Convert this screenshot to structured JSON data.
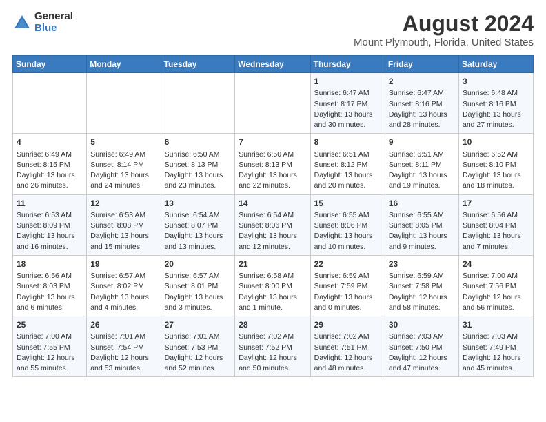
{
  "logo": {
    "line1": "General",
    "line2": "Blue"
  },
  "title": "August 2024",
  "subtitle": "Mount Plymouth, Florida, United States",
  "weekdays": [
    "Sunday",
    "Monday",
    "Tuesday",
    "Wednesday",
    "Thursday",
    "Friday",
    "Saturday"
  ],
  "weeks": [
    [
      {
        "day": "",
        "content": ""
      },
      {
        "day": "",
        "content": ""
      },
      {
        "day": "",
        "content": ""
      },
      {
        "day": "",
        "content": ""
      },
      {
        "day": "1",
        "content": "Sunrise: 6:47 AM\nSunset: 8:17 PM\nDaylight: 13 hours\nand 30 minutes."
      },
      {
        "day": "2",
        "content": "Sunrise: 6:47 AM\nSunset: 8:16 PM\nDaylight: 13 hours\nand 28 minutes."
      },
      {
        "day": "3",
        "content": "Sunrise: 6:48 AM\nSunset: 8:16 PM\nDaylight: 13 hours\nand 27 minutes."
      }
    ],
    [
      {
        "day": "4",
        "content": "Sunrise: 6:49 AM\nSunset: 8:15 PM\nDaylight: 13 hours\nand 26 minutes."
      },
      {
        "day": "5",
        "content": "Sunrise: 6:49 AM\nSunset: 8:14 PM\nDaylight: 13 hours\nand 24 minutes."
      },
      {
        "day": "6",
        "content": "Sunrise: 6:50 AM\nSunset: 8:13 PM\nDaylight: 13 hours\nand 23 minutes."
      },
      {
        "day": "7",
        "content": "Sunrise: 6:50 AM\nSunset: 8:13 PM\nDaylight: 13 hours\nand 22 minutes."
      },
      {
        "day": "8",
        "content": "Sunrise: 6:51 AM\nSunset: 8:12 PM\nDaylight: 13 hours\nand 20 minutes."
      },
      {
        "day": "9",
        "content": "Sunrise: 6:51 AM\nSunset: 8:11 PM\nDaylight: 13 hours\nand 19 minutes."
      },
      {
        "day": "10",
        "content": "Sunrise: 6:52 AM\nSunset: 8:10 PM\nDaylight: 13 hours\nand 18 minutes."
      }
    ],
    [
      {
        "day": "11",
        "content": "Sunrise: 6:53 AM\nSunset: 8:09 PM\nDaylight: 13 hours\nand 16 minutes."
      },
      {
        "day": "12",
        "content": "Sunrise: 6:53 AM\nSunset: 8:08 PM\nDaylight: 13 hours\nand 15 minutes."
      },
      {
        "day": "13",
        "content": "Sunrise: 6:54 AM\nSunset: 8:07 PM\nDaylight: 13 hours\nand 13 minutes."
      },
      {
        "day": "14",
        "content": "Sunrise: 6:54 AM\nSunset: 8:06 PM\nDaylight: 13 hours\nand 12 minutes."
      },
      {
        "day": "15",
        "content": "Sunrise: 6:55 AM\nSunset: 8:06 PM\nDaylight: 13 hours\nand 10 minutes."
      },
      {
        "day": "16",
        "content": "Sunrise: 6:55 AM\nSunset: 8:05 PM\nDaylight: 13 hours\nand 9 minutes."
      },
      {
        "day": "17",
        "content": "Sunrise: 6:56 AM\nSunset: 8:04 PM\nDaylight: 13 hours\nand 7 minutes."
      }
    ],
    [
      {
        "day": "18",
        "content": "Sunrise: 6:56 AM\nSunset: 8:03 PM\nDaylight: 13 hours\nand 6 minutes."
      },
      {
        "day": "19",
        "content": "Sunrise: 6:57 AM\nSunset: 8:02 PM\nDaylight: 13 hours\nand 4 minutes."
      },
      {
        "day": "20",
        "content": "Sunrise: 6:57 AM\nSunset: 8:01 PM\nDaylight: 13 hours\nand 3 minutes."
      },
      {
        "day": "21",
        "content": "Sunrise: 6:58 AM\nSunset: 8:00 PM\nDaylight: 13 hours\nand 1 minute."
      },
      {
        "day": "22",
        "content": "Sunrise: 6:59 AM\nSunset: 7:59 PM\nDaylight: 13 hours\nand 0 minutes."
      },
      {
        "day": "23",
        "content": "Sunrise: 6:59 AM\nSunset: 7:58 PM\nDaylight: 12 hours\nand 58 minutes."
      },
      {
        "day": "24",
        "content": "Sunrise: 7:00 AM\nSunset: 7:56 PM\nDaylight: 12 hours\nand 56 minutes."
      }
    ],
    [
      {
        "day": "25",
        "content": "Sunrise: 7:00 AM\nSunset: 7:55 PM\nDaylight: 12 hours\nand 55 minutes."
      },
      {
        "day": "26",
        "content": "Sunrise: 7:01 AM\nSunset: 7:54 PM\nDaylight: 12 hours\nand 53 minutes."
      },
      {
        "day": "27",
        "content": "Sunrise: 7:01 AM\nSunset: 7:53 PM\nDaylight: 12 hours\nand 52 minutes."
      },
      {
        "day": "28",
        "content": "Sunrise: 7:02 AM\nSunset: 7:52 PM\nDaylight: 12 hours\nand 50 minutes."
      },
      {
        "day": "29",
        "content": "Sunrise: 7:02 AM\nSunset: 7:51 PM\nDaylight: 12 hours\nand 48 minutes."
      },
      {
        "day": "30",
        "content": "Sunrise: 7:03 AM\nSunset: 7:50 PM\nDaylight: 12 hours\nand 47 minutes."
      },
      {
        "day": "31",
        "content": "Sunrise: 7:03 AM\nSunset: 7:49 PM\nDaylight: 12 hours\nand 45 minutes."
      }
    ]
  ]
}
